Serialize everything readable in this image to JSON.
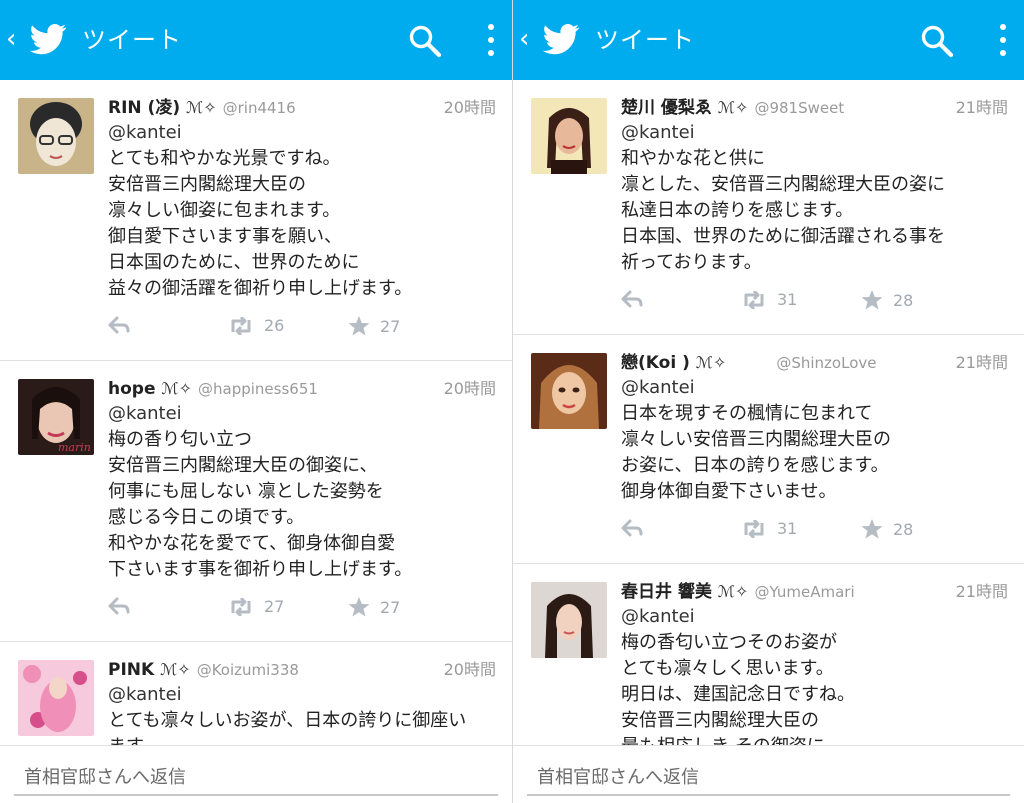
{
  "panes": [
    {
      "header": {
        "back": "‹",
        "title": "ツイート"
      },
      "tweets": [
        {
          "name": "RIN (凌)",
          "badge": "ℳ✧",
          "handle": "@rin4416",
          "time": "20時間",
          "reply_to": "@kantei",
          "text": "とても和やかな光景ですね。\n安倍晋三内閣総理大臣の\n凛々しい御姿に包まれます。\n御自愛下さいます事を願い、\n日本国のために、世界のために\n益々の御活躍を御祈り申し上げます。",
          "retweets": "26",
          "favorites": "27",
          "avatar_colors": [
            "#c9b48a",
            "#f0e6d6",
            "#2a2a2a"
          ]
        },
        {
          "name": "hope",
          "badge": "ℳ✧",
          "handle": "@happiness651",
          "time": "20時間",
          "reply_to": "@kantei",
          "text": "梅の香り匂い立つ\n安倍晋三内閣総理大臣の御姿に、\n何事にも屈しない 凛とした姿勢を\n感じる今日この頃です。\n和やかな花を愛でて、御身体御自愛\n下さいます事を御祈り申し上げます。",
          "retweets": "27",
          "favorites": "27",
          "avatar_colors": [
            "#2b1b18",
            "#e9c7b4",
            "#c43b57"
          ]
        },
        {
          "name": "PINK",
          "badge": "ℳ✧",
          "handle": "@Koizumi338",
          "time": "20時間",
          "reply_to": "@kantei",
          "text": "とても凛々しいお姿が、日本の誇りに御座い\nます。\n建国記念の日を前に",
          "retweets": "",
          "favorites": "",
          "avatar_colors": [
            "#f08fb7",
            "#f7c9dc",
            "#d64f8a"
          ]
        }
      ],
      "composer": {
        "placeholder": "首相官邸さんへ返信"
      }
    },
    {
      "header": {
        "back": "‹",
        "title": "ツイート"
      },
      "tweets": [
        {
          "name": "楚川 優梨ゑ",
          "badge": "ℳ✧",
          "handle": "@981Sweet",
          "time": "21時間",
          "reply_to": "@kantei",
          "text": "和やかな花と供に\n凛とした、安倍晋三内閣総理大臣の姿に\n私達日本の誇りを感じます。\n日本国、世界のために御活躍される事を\n祈っております。",
          "retweets": "31",
          "favorites": "28",
          "avatar_colors": [
            "#f3e7b8",
            "#e8b89a",
            "#3a1f17"
          ]
        },
        {
          "name": "戀(Koi )",
          "badge": "ℳ✧",
          "handle": "@ShinzoLove",
          "time": "21時間",
          "reply_to": "@kantei",
          "text": "日本を現すその楓情に包まれて\n凛々しい安倍晋三内閣総理大臣の\nお姿に、日本の誇りを感じます。\n御身体御自愛下さいませ。",
          "retweets": "31",
          "favorites": "28",
          "avatar_colors": [
            "#b0713f",
            "#f0c7a4",
            "#5a2c18"
          ]
        },
        {
          "name": "春日井 響美",
          "badge": "ℳ✧",
          "handle": "@YumeAmari",
          "time": "21時間",
          "reply_to": "@kantei",
          "text": "梅の香匂い立つそのお姿が\nとても凛々しく思います。\n明日は、建国記念日ですね。\n安倍晋三内閣総理大臣の\n最も相応しき その御姿に\n日本の誇りを感じます。",
          "retweets": "",
          "favorites": "",
          "avatar_colors": [
            "#dcd7d2",
            "#f1d1bf",
            "#2c1a14"
          ]
        }
      ],
      "composer": {
        "placeholder": "首相官邸さんへ返信"
      }
    }
  ],
  "colors": {
    "appbar": "#00acee",
    "icon_gray": "#b5bcc3"
  },
  "icons": {
    "back": "chevron-left-icon",
    "logo": "twitter-bird-icon",
    "search": "search-icon",
    "menu": "overflow-menu-icon",
    "reply": "reply-icon",
    "retweet": "retweet-icon",
    "favorite": "star-icon"
  }
}
